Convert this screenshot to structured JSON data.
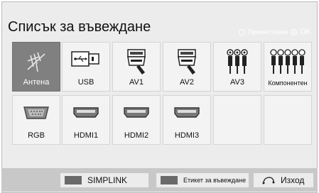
{
  "header": {
    "title": "Списък за въвеждане",
    "hint_move": "Преместване",
    "hint_ok": "OK"
  },
  "inputs": [
    {
      "label": "Антена",
      "icon": "antenna-icon",
      "selected": true
    },
    {
      "label": "USB",
      "icon": "usb-icon",
      "selected": false
    },
    {
      "label": "AV1",
      "icon": "scart-icon",
      "selected": false
    },
    {
      "label": "AV2",
      "icon": "scart-icon",
      "selected": false
    },
    {
      "label": "AV3",
      "icon": "rca-composite-icon",
      "selected": false
    },
    {
      "label": "Компонентен",
      "icon": "rca-component-icon",
      "selected": false
    },
    {
      "label": "RGB",
      "icon": "vga-icon",
      "selected": false
    },
    {
      "label": "HDMI1",
      "icon": "hdmi-icon",
      "selected": false
    },
    {
      "label": "HDMI2",
      "icon": "hdmi-icon",
      "selected": false
    },
    {
      "label": "HDMI3",
      "icon": "hdmi-icon",
      "selected": false
    }
  ],
  "footer": {
    "simplink": "SIMPLINK",
    "input_label": "Етикет за въвеждане",
    "exit": "Изход"
  }
}
